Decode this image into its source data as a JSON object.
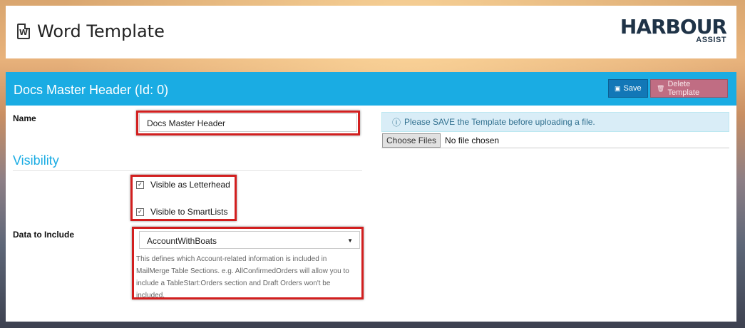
{
  "page": {
    "title": "Word Template"
  },
  "logo": {
    "main": "HARBOUR",
    "sub": "ASSIST"
  },
  "panel": {
    "title": "Docs Master Header (Id: 0)",
    "save_label": "Save",
    "delete_label": "Delete Template"
  },
  "form": {
    "name_label": "Name",
    "name_value": "Docs Master Header",
    "visibility_title": "Visibility",
    "visible_letterhead": "Visible as Letterhead",
    "visible_smartlists": "Visible to SmartLists",
    "data_label": "Data to Include",
    "data_value": "AccountWithBoats",
    "help_text": "This defines which Account-related information is included in MailMerge Table Sections. e.g. AllConfirmedOrders will allow you to include a TableStart:Orders section and Draft Orders won't be included."
  },
  "upload": {
    "info": "Please SAVE the Template before uploading a file.",
    "choose_label": "Choose Files",
    "status": "No file chosen"
  },
  "colors": {
    "accent": "#1aace3",
    "highlight": "#d21f1f",
    "delete": "#c06d83"
  }
}
